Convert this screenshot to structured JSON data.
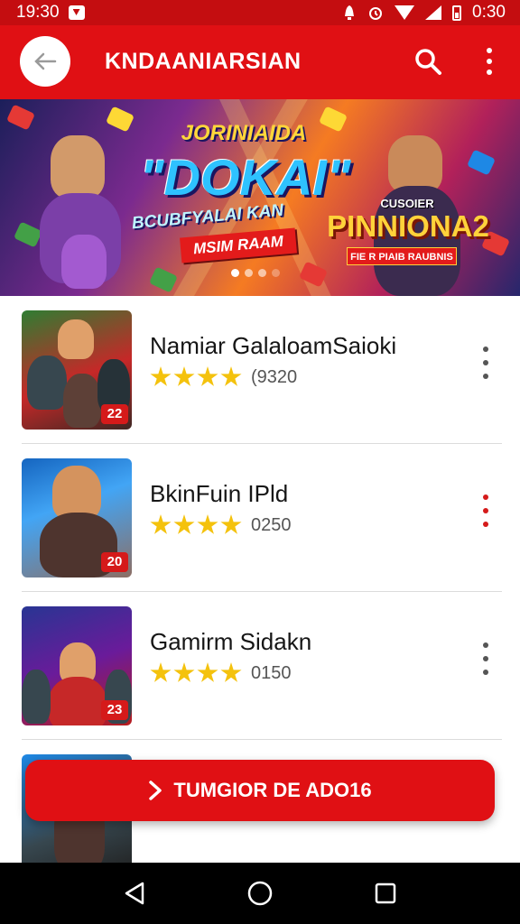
{
  "status_bar": {
    "time_left": "19:30",
    "time_right": "0:30"
  },
  "app_bar": {
    "title": "KNDAANIARSIAN"
  },
  "banner": {
    "top_text": "JORINIAIDA",
    "main_text": "\"DOKAI\"",
    "subline": "BCUBFYALAI KAN",
    "ribbon": "MSIM RAAM",
    "right_top": "CUSOIER",
    "right_main": "PINNIONA2",
    "right_ribbon": "FIE R PIAIB RAUBNIS",
    "slide_count": 4,
    "active_slide": 0
  },
  "games": [
    {
      "title": "Namiar GalaloamSaioki",
      "rating": 4,
      "count": "(9320",
      "badge": "22",
      "more_color": "gray"
    },
    {
      "title": "BkinFuin IPld",
      "rating": 4,
      "count": "0250",
      "badge": "20",
      "more_color": "red"
    },
    {
      "title": "Gamirm Sidakn",
      "rating": 4,
      "count": "0150",
      "badge": "23",
      "more_color": "gray"
    }
  ],
  "cta": {
    "label": "TUMGIOR DE ADO16"
  },
  "colors": {
    "primary": "#e01014",
    "status": "#c40d10",
    "star": "#f4c20d"
  },
  "icons": [
    "back-arrow-icon",
    "search-icon",
    "more-vertical-icon",
    "star-icon",
    "chevron-right-icon",
    "nav-back-icon",
    "nav-home-icon",
    "nav-recents-icon"
  ]
}
